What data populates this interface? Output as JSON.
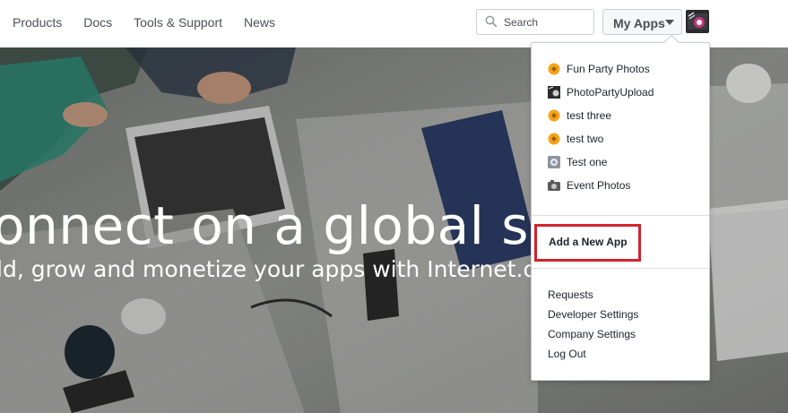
{
  "nav": {
    "items": [
      "Products",
      "Docs",
      "Tools & Support",
      "News"
    ]
  },
  "search": {
    "placeholder": "Search"
  },
  "myapps": {
    "label": "My Apps"
  },
  "hero": {
    "title": "onnect on a global scal",
    "subtitle": "ld, grow and monetize your apps with Internet.or"
  },
  "dropdown": {
    "apps": [
      {
        "name": "Fun Party Photos",
        "icon": "orange-app-icon"
      },
      {
        "name": "PhotoPartyUpload",
        "icon": "photo-thumbnail-icon"
      },
      {
        "name": "test three",
        "icon": "orange-app-icon"
      },
      {
        "name": "test two",
        "icon": "orange-app-icon"
      },
      {
        "name": "Test one",
        "icon": "gear-app-icon"
      },
      {
        "name": "Event Photos",
        "icon": "camera-icon"
      }
    ],
    "add_app": "Add a New App",
    "links": [
      "Requests",
      "Developer Settings",
      "Company Settings",
      "Log Out"
    ]
  },
  "colors": {
    "highlight_border": "#d2222d",
    "text": "#1d2129",
    "nav_text": "#4b4f56"
  }
}
